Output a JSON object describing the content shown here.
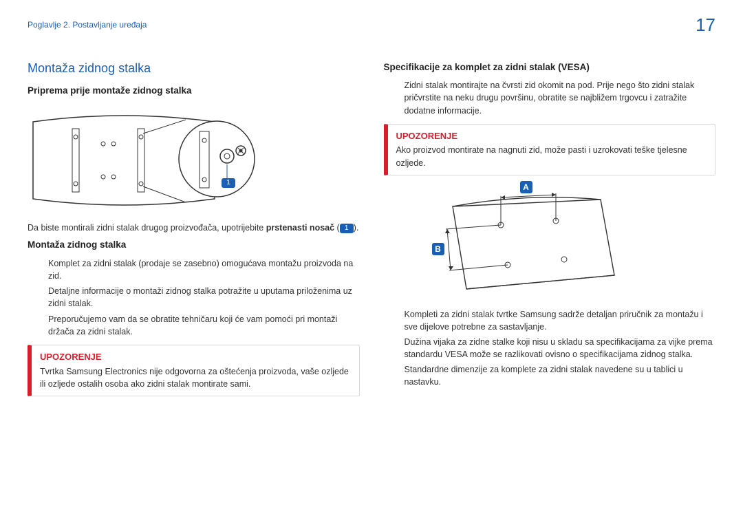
{
  "header": {
    "chapter": "Poglavlje 2. Postavljanje uređaja",
    "page_number": "17"
  },
  "left": {
    "title": "Montaža zidnog stalka",
    "sub1": "Priprema prije montaže zidnog stalka",
    "figure_callout": "1",
    "after_fig_before": "Da biste montirali zidni stalak drugog proizvođača, upotrijebite ",
    "after_fig_bold": "prstenasti nosač",
    "after_fig_paren_open": " (",
    "after_fig_callout": "1",
    "after_fig_paren_close": ").",
    "sub2": "Montaža zidnog stalka",
    "p1": "Komplet za zidni stalak (prodaje se zasebno) omogućava montažu proizvoda na zid.",
    "p2": "Detaljne informacije o montaži zidnog stalka potražite u uputama priloženima uz zidni stalak.",
    "p3": "Preporučujemo vam da se obratite tehničaru koji će vam pomoći pri montaži držača za zidni stalak.",
    "warn_title": "UPOZORENJE",
    "warn_body": "Tvrtka Samsung Electronics nije odgovorna za oštećenja proizvoda, vaše ozljede ili ozljede ostalih osoba ako zidni stalak montirate sami."
  },
  "right": {
    "sub1": "Specifikacije za komplet za zidni stalak (VESA)",
    "p1": "Zidni stalak montirajte na čvrsti zid okomit na pod. Prije nego što zidni stalak pričvrstite na neku drugu površinu, obratite se najbližem trgovcu i zatražite dodatne informacije.",
    "warn_title": "UPOZORENJE",
    "warn_body": "Ako proizvod montirate na nagnuti zid, može pasti i uzrokovati teške tjelesne ozljede.",
    "label_a": "A",
    "label_b": "B",
    "p2": "Kompleti za zidni stalak tvrtke Samsung sadrže detaljan priručnik za montažu i sve dijelove potrebne za sastavljanje.",
    "p3": "Dužina vijaka za zidne stalke koji nisu u skladu sa specifikacijama za vijke prema standardu VESA može se razlikovati ovisno o specifikacijama zidnog stalka.",
    "p4": "Standardne dimenzije za komplete za zidni stalak navedene su u tablici u nastavku."
  }
}
